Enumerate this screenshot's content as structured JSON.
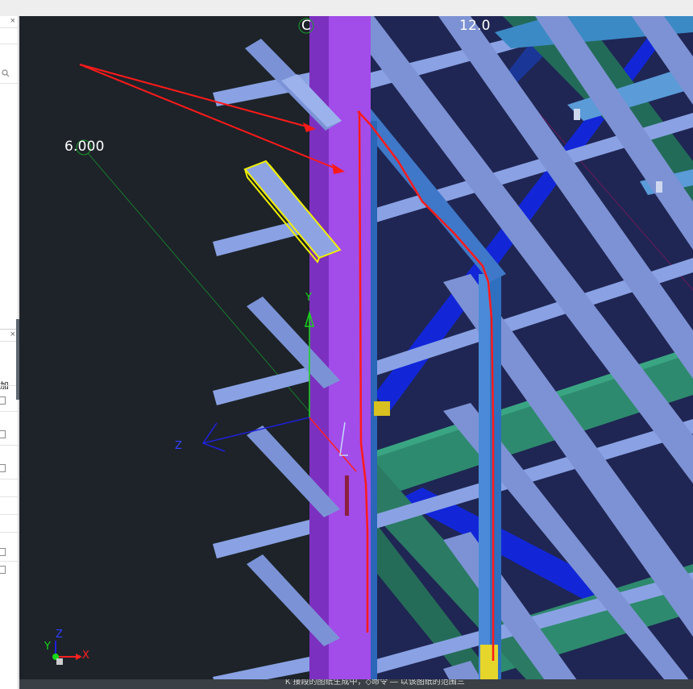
{
  "viewport": {
    "grid_label_left": "6.000",
    "grid_label_top_left": "C",
    "grid_label_top_right": "12.0",
    "axis_y_label": "Y",
    "axis_z_label": "Z",
    "mini_axis_x": "X",
    "mini_axis_y": "Y",
    "mini_axis_z": "Z",
    "status_text": "K 接段的图纸生成中，◇命令 — 以该图纸的范围三"
  },
  "left_panel": {
    "close_glyph": "×",
    "search_icon": "search-icon",
    "add_label": "加"
  },
  "colors": {
    "background": "#1d2329",
    "purpose_column": "#9b47dc",
    "purlin_blue": "#8aa2e4",
    "selected_yellow": "#f0f000",
    "green_beam": "#2e8a6e",
    "blue_brace": "#1226d8",
    "red_markup": "#ff1a1a"
  }
}
